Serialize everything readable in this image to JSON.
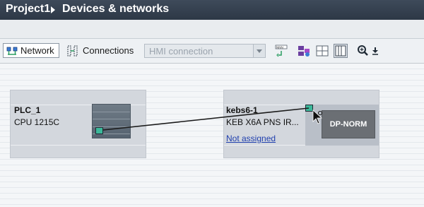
{
  "header": {
    "breadcrumb": [
      "Project1",
      "Devices & networks"
    ]
  },
  "toolbar": {
    "network_label": "Network",
    "connections_label": "Connections",
    "connection_type": "HMI connection",
    "icons": [
      "network-view-icon",
      "connections-icon",
      "dropdown-icon",
      "address-icon",
      "highlight-icon",
      "grid-icon",
      "table-view-icon",
      "zoom-icon",
      "download-icon"
    ]
  },
  "devices": [
    {
      "name": "PLC_1",
      "type": "CPU 1215C"
    },
    {
      "name": "kebs6-1",
      "type": "KEB X6A PNS IR...",
      "status": "Not assigned",
      "module": "DP-NORM"
    }
  ],
  "colors": {
    "title_bar": "#34404e",
    "device_card": "#d3d7dd",
    "port": "#3cb89a",
    "link": "#1f3fae",
    "module": "#6b6f74"
  }
}
